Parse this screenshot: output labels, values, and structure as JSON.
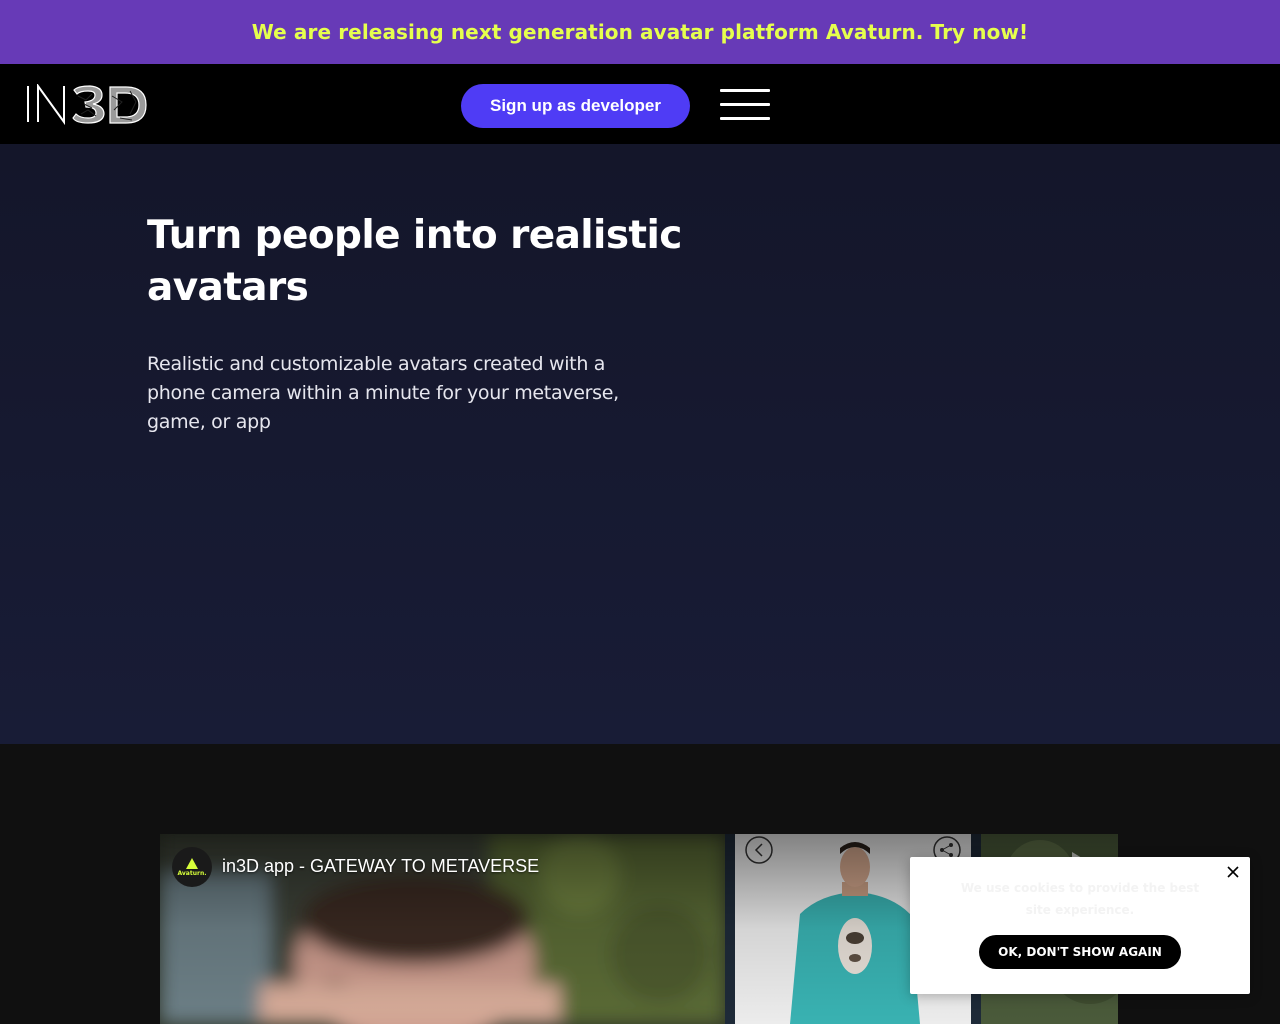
{
  "banner": {
    "text": "We are releasing next generation avatar platform Avaturn. Try now!",
    "background_color": "#673ab7",
    "text_color": "#e6ff4d"
  },
  "header": {
    "logo_text": "IN3D",
    "signup_label": "Sign up as developer",
    "signup_color": "#4f3cf5",
    "menu_icon": "hamburger-menu-icon"
  },
  "hero": {
    "title": "Turn people into realistic avatars",
    "subtitle": "Realistic and customizable avatars created with a phone camera within a minute for your metaverse, game, or app"
  },
  "video": {
    "channel_name": "Avaturn.",
    "title": "in3D app - GATEWAY TO METAVERSE",
    "icons": [
      "back-arrow-icon",
      "share-icon"
    ]
  },
  "cookie": {
    "text": "We use cookies to provide the best site experience.",
    "ok_label": "OK, DON'T SHOW AGAIN",
    "close_icon": "close-icon"
  }
}
